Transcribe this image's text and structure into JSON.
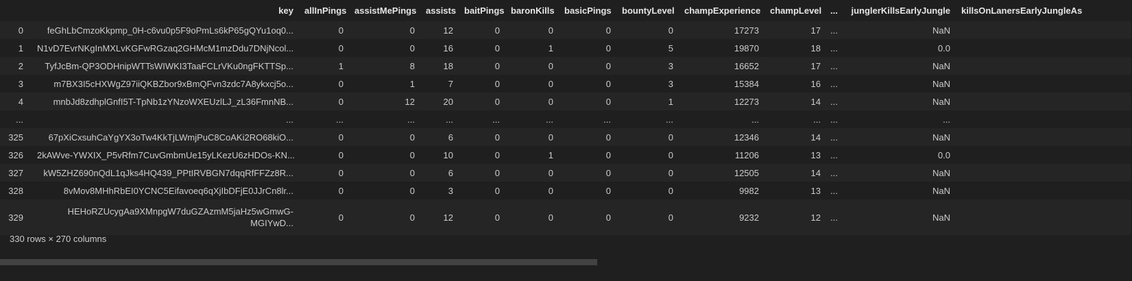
{
  "table": {
    "columns": [
      "key",
      "allInPings",
      "assistMePings",
      "assists",
      "baitPings",
      "baronKills",
      "basicPings",
      "bountyLevel",
      "champExperience",
      "champLevel",
      "...",
      "junglerKillsEarlyJungle",
      "killsOnLanersEarlyJungleAs"
    ],
    "rows": [
      {
        "index": "0",
        "cells": [
          "feGhLbCmzoKkpmp_0H-c6vu0p5F9oPmLs6kP65gQYu1oq0...",
          "0",
          "0",
          "12",
          "0",
          "0",
          "0",
          "0",
          "17273",
          "17",
          "...",
          "NaN",
          ""
        ]
      },
      {
        "index": "1",
        "cells": [
          "N1vD7EvrNKgInMXLvKGFwRGzaq2GHMcM1mzDdu7DNjNcol...",
          "0",
          "0",
          "16",
          "0",
          "1",
          "0",
          "5",
          "19870",
          "18",
          "...",
          "0.0",
          ""
        ]
      },
      {
        "index": "2",
        "cells": [
          "TyfJcBm-QP3ODHnipWTTsWIWKI3TaaFCLrVKu0ngFKTTSp...",
          "1",
          "8",
          "18",
          "0",
          "0",
          "0",
          "3",
          "16652",
          "17",
          "...",
          "NaN",
          ""
        ]
      },
      {
        "index": "3",
        "cells": [
          "m7BX3I5cHXWgZ97iiQKBZbor9xBmQFvn3zdc7A8ykxcj5o...",
          "0",
          "1",
          "7",
          "0",
          "0",
          "0",
          "3",
          "15384",
          "16",
          "...",
          "NaN",
          ""
        ]
      },
      {
        "index": "4",
        "cells": [
          "mnbJd8zdhplGnfI5T-TpNb1zYNzoWXEUzlLJ_zL36FmnNB...",
          "0",
          "12",
          "20",
          "0",
          "0",
          "0",
          "1",
          "12273",
          "14",
          "...",
          "NaN",
          ""
        ]
      },
      {
        "index": "...",
        "cells": [
          "...",
          "...",
          "...",
          "...",
          "...",
          "...",
          "...",
          "...",
          "...",
          "...",
          "...",
          "...",
          ""
        ]
      },
      {
        "index": "325",
        "cells": [
          "67pXiCxsuhCaYgYX3oTw4KkTjLWmjPuC8CoAKi2RO68kiO...",
          "0",
          "0",
          "6",
          "0",
          "0",
          "0",
          "0",
          "12346",
          "14",
          "...",
          "NaN",
          ""
        ]
      },
      {
        "index": "326",
        "cells": [
          "2kAWve-YWXIX_P5vRfm7CuvGmbmUe15yLKezU6zHDOs-KN...",
          "0",
          "0",
          "10",
          "0",
          "1",
          "0",
          "0",
          "11206",
          "13",
          "...",
          "0.0",
          ""
        ]
      },
      {
        "index": "327",
        "cells": [
          "kW5ZHZ690nQdL1qJks4HQ439_PPtIRVBGN7dqqRfFFZz8R...",
          "0",
          "0",
          "6",
          "0",
          "0",
          "0",
          "0",
          "12505",
          "14",
          "...",
          "NaN",
          ""
        ]
      },
      {
        "index": "328",
        "cells": [
          "8vMov8MHhRbEI0YCNC5Eifavoeq6qXjIbDFjE0JJrCn8lr...",
          "0",
          "0",
          "3",
          "0",
          "0",
          "0",
          "0",
          "9982",
          "13",
          "...",
          "NaN",
          ""
        ]
      },
      {
        "index": "329",
        "cells": [
          "HEHoRZUcygAa9XMnpgW7duGZAzmM5jaHz5wGmwG-MGIYwD...",
          "0",
          "0",
          "12",
          "0",
          "0",
          "0",
          "0",
          "9232",
          "12",
          "...",
          "NaN",
          ""
        ]
      }
    ]
  },
  "shape_text": "330 rows × 270 columns"
}
